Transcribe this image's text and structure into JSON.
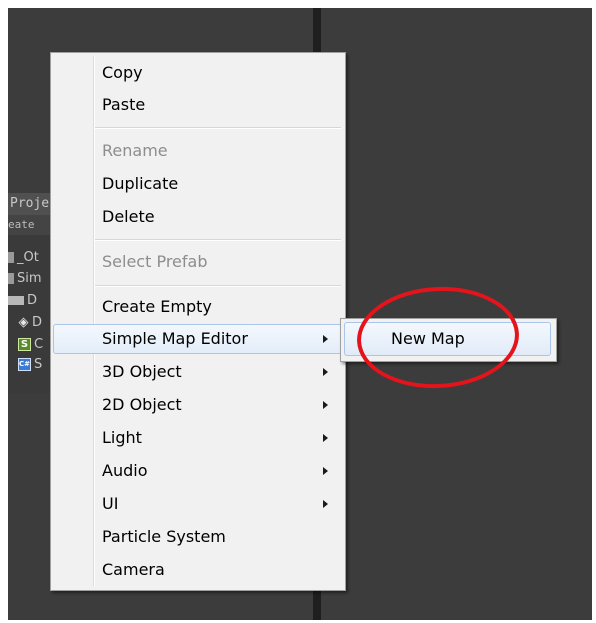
{
  "project_panel": {
    "tab_label": "Proje",
    "toolbar_label": "eate",
    "tree": [
      {
        "label": "_Ot",
        "icon": "folder-icon"
      },
      {
        "label": "Sim",
        "icon": "folder-icon"
      },
      {
        "label": "D",
        "icon": "folder-open-icon"
      },
      {
        "label": "D",
        "icon": "unity-scene-icon"
      },
      {
        "label": "C",
        "icon": "shader-icon",
        "icon_text": "S"
      },
      {
        "label": "S",
        "icon": "csharp-script-icon",
        "icon_text": "C#"
      }
    ]
  },
  "context_menu": {
    "items": [
      {
        "label": "Copy",
        "enabled": true
      },
      {
        "label": "Paste",
        "enabled": true
      },
      {
        "label": "Rename",
        "enabled": false
      },
      {
        "label": "Duplicate",
        "enabled": true
      },
      {
        "label": "Delete",
        "enabled": true
      },
      {
        "label": "Select Prefab",
        "enabled": false
      },
      {
        "label": "Create Empty",
        "enabled": true
      },
      {
        "label": "Simple Map Editor",
        "enabled": true,
        "submenu": true,
        "highlighted": true
      },
      {
        "label": "3D Object",
        "enabled": true,
        "submenu": true
      },
      {
        "label": "2D Object",
        "enabled": true,
        "submenu": true
      },
      {
        "label": "Light",
        "enabled": true,
        "submenu": true
      },
      {
        "label": "Audio",
        "enabled": true,
        "submenu": true
      },
      {
        "label": "UI",
        "enabled": true,
        "submenu": true
      },
      {
        "label": "Particle System",
        "enabled": true
      },
      {
        "label": "Camera",
        "enabled": true
      }
    ]
  },
  "submenu": {
    "items": [
      {
        "label": "New Map",
        "highlighted": true
      }
    ]
  },
  "colors": {
    "editor_bg": "#3c3c3c",
    "menu_bg": "#f1f1f1",
    "highlight_border": "#a9c6ea",
    "annotation_red": "#e3141b"
  }
}
